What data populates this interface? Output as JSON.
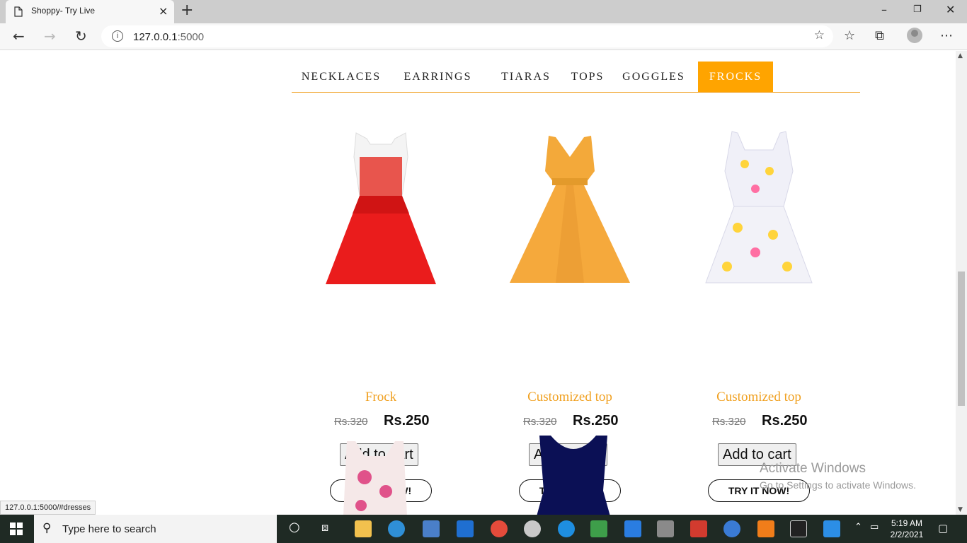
{
  "browser": {
    "tab_title": "Shoppy- Try Live",
    "tab_close": "×",
    "new_tab": "+",
    "url_host": "127.0.0.1",
    "url_port": ":5000",
    "status_url": "127.0.0.1:5000/#dresses",
    "window_controls": [
      "–",
      "❐",
      "✕"
    ]
  },
  "nav": {
    "categories": [
      "NECKLACES",
      "EARRINGS",
      "TIARAS",
      "TOPS",
      "GOGGLES",
      "FROCKS"
    ],
    "active": "FROCKS",
    "accent": "#ffa400"
  },
  "products": [
    {
      "name": "Frock",
      "old_price": "Rs.320",
      "price": "Rs.250",
      "cart_label": "Add to cart",
      "try_label": "TRY IT NOW!",
      "image": "red-lace-dress"
    },
    {
      "name": "Customized top",
      "old_price": "Rs.320",
      "price": "Rs.250",
      "cart_label": "Add to cart",
      "try_label": "TRY IT NOW!",
      "image": "mustard-dress"
    },
    {
      "name": "Customized top",
      "old_price": "Rs.320",
      "price": "Rs.250",
      "cart_label": "Add to cart",
      "try_label": "TRY IT NOW!",
      "image": "emoji-print-dress"
    }
  ],
  "partial_products": [
    {
      "image": "floral-dress"
    },
    {
      "image": "navy-dress"
    }
  ],
  "watermark": {
    "line1": "Activate Windows",
    "line2": "Go to Settings to activate Windows."
  },
  "taskbar": {
    "search_placeholder": "Type here to search",
    "time": "5:19 AM",
    "date": "2/2/2021"
  }
}
